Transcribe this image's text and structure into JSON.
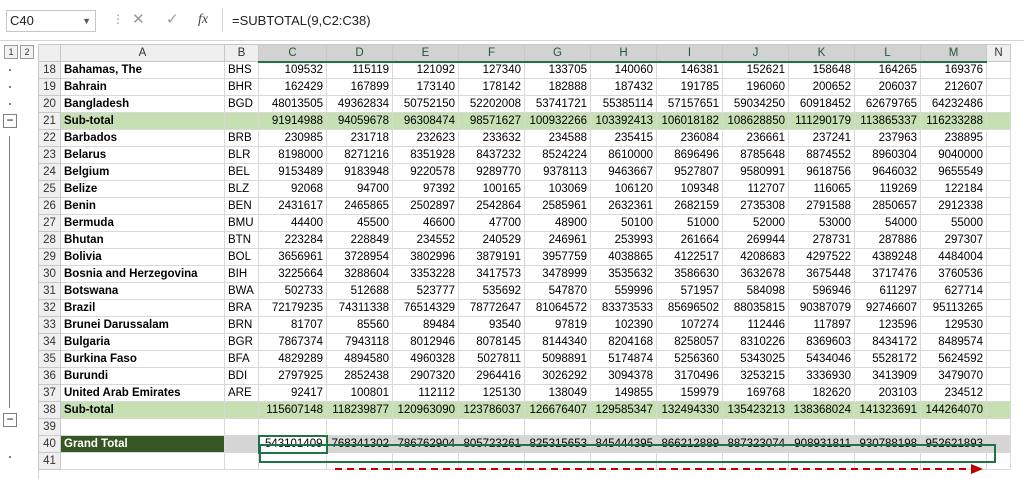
{
  "namebox": {
    "value": "C40"
  },
  "formula": {
    "fx": "fx",
    "value": "=SUBTOTAL(9,C2:C38)"
  },
  "levels": [
    "1",
    "2"
  ],
  "columns": [
    "A",
    "B",
    "C",
    "D",
    "E",
    "F",
    "G",
    "H",
    "I",
    "J",
    "K",
    "L",
    "M",
    "N"
  ],
  "rows": [
    {
      "n": "18",
      "type": "data",
      "name": "Bahamas, The",
      "code": "BHS",
      "v": [
        "109532",
        "115119",
        "121092",
        "127340",
        "133705",
        "140060",
        "146381",
        "152621",
        "158648",
        "164265",
        "169376"
      ]
    },
    {
      "n": "19",
      "type": "data",
      "name": "Bahrain",
      "code": "BHR",
      "v": [
        "162429",
        "167899",
        "173140",
        "178142",
        "182888",
        "187432",
        "191785",
        "196060",
        "200652",
        "206037",
        "212607"
      ]
    },
    {
      "n": "20",
      "type": "data",
      "name": "Bangladesh",
      "code": "BGD",
      "v": [
        "48013505",
        "49362834",
        "50752150",
        "52202008",
        "53741721",
        "55385114",
        "57157651",
        "59034250",
        "60918452",
        "62679765",
        "64232486"
      ]
    },
    {
      "n": "21",
      "type": "sub",
      "name": "Sub-total",
      "code": "",
      "v": [
        "91914988",
        "94059678",
        "96308474",
        "98571627",
        "100932266",
        "103392413",
        "106018182",
        "108628850",
        "111290179",
        "113865337",
        "116233288"
      ]
    },
    {
      "n": "22",
      "type": "data",
      "name": "Barbados",
      "code": "BRB",
      "v": [
        "230985",
        "231718",
        "232623",
        "233632",
        "234588",
        "235415",
        "236084",
        "236661",
        "237241",
        "237963",
        "238895"
      ]
    },
    {
      "n": "23",
      "type": "data",
      "name": "Belarus",
      "code": "BLR",
      "v": [
        "8198000",
        "8271216",
        "8351928",
        "8437232",
        "8524224",
        "8610000",
        "8696496",
        "8785648",
        "8874552",
        "8960304",
        "9040000"
      ]
    },
    {
      "n": "24",
      "type": "data",
      "name": "Belgium",
      "code": "BEL",
      "v": [
        "9153489",
        "9183948",
        "9220578",
        "9289770",
        "9378113",
        "9463667",
        "9527807",
        "9580991",
        "9618756",
        "9646032",
        "9655549"
      ]
    },
    {
      "n": "25",
      "type": "data",
      "name": "Belize",
      "code": "BLZ",
      "v": [
        "92068",
        "94700",
        "97392",
        "100165",
        "103069",
        "106120",
        "109348",
        "112707",
        "116065",
        "119269",
        "122184"
      ]
    },
    {
      "n": "26",
      "type": "data",
      "name": "Benin",
      "code": "BEN",
      "v": [
        "2431617",
        "2465865",
        "2502897",
        "2542864",
        "2585961",
        "2632361",
        "2682159",
        "2735308",
        "2791588",
        "2850657",
        "2912338"
      ]
    },
    {
      "n": "27",
      "type": "data",
      "name": "Bermuda",
      "code": "BMU",
      "v": [
        "44400",
        "45500",
        "46600",
        "47700",
        "48900",
        "50100",
        "51000",
        "52000",
        "53000",
        "54000",
        "55000"
      ]
    },
    {
      "n": "28",
      "type": "data",
      "name": "Bhutan",
      "code": "BTN",
      "v": [
        "223284",
        "228849",
        "234552",
        "240529",
        "246961",
        "253993",
        "261664",
        "269944",
        "278731",
        "287886",
        "297307"
      ]
    },
    {
      "n": "29",
      "type": "data",
      "name": "Bolivia",
      "code": "BOL",
      "v": [
        "3656961",
        "3728954",
        "3802996",
        "3879191",
        "3957759",
        "4038865",
        "4122517",
        "4208683",
        "4297522",
        "4389248",
        "4484004"
      ]
    },
    {
      "n": "30",
      "type": "data",
      "name": "Bosnia and Herzegovina",
      "code": "BIH",
      "v": [
        "3225664",
        "3288604",
        "3353228",
        "3417573",
        "3478999",
        "3535632",
        "3586630",
        "3632678",
        "3675448",
        "3717476",
        "3760536"
      ]
    },
    {
      "n": "31",
      "type": "data",
      "name": "Botswana",
      "code": "BWA",
      "v": [
        "502733",
        "512688",
        "523777",
        "535692",
        "547870",
        "559996",
        "571957",
        "584098",
        "596946",
        "611297",
        "627714"
      ]
    },
    {
      "n": "32",
      "type": "data",
      "name": "Brazil",
      "code": "BRA",
      "v": [
        "72179235",
        "74311338",
        "76514329",
        "78772647",
        "81064572",
        "83373533",
        "85696502",
        "88035815",
        "90387079",
        "92746607",
        "95113265"
      ]
    },
    {
      "n": "33",
      "type": "data",
      "name": "Brunei Darussalam",
      "code": "BRN",
      "v": [
        "81707",
        "85560",
        "89484",
        "93540",
        "97819",
        "102390",
        "107274",
        "112446",
        "117897",
        "123596",
        "129530"
      ]
    },
    {
      "n": "34",
      "type": "data",
      "name": "Bulgaria",
      "code": "BGR",
      "v": [
        "7867374",
        "7943118",
        "8012946",
        "8078145",
        "8144340",
        "8204168",
        "8258057",
        "8310226",
        "8369603",
        "8434172",
        "8489574"
      ]
    },
    {
      "n": "35",
      "type": "data",
      "name": "Burkina Faso",
      "code": "BFA",
      "v": [
        "4829289",
        "4894580",
        "4960328",
        "5027811",
        "5098891",
        "5174874",
        "5256360",
        "5343025",
        "5434046",
        "5528172",
        "5624592"
      ]
    },
    {
      "n": "36",
      "type": "data",
      "name": "Burundi",
      "code": "BDI",
      "v": [
        "2797925",
        "2852438",
        "2907320",
        "2964416",
        "3026292",
        "3094378",
        "3170496",
        "3253215",
        "3336930",
        "3413909",
        "3479070"
      ]
    },
    {
      "n": "37",
      "type": "data",
      "name": "United Arab Emirates",
      "code": "ARE",
      "v": [
        "92417",
        "100801",
        "112112",
        "125130",
        "138049",
        "149855",
        "159979",
        "169768",
        "182620",
        "203103",
        "234512"
      ]
    },
    {
      "n": "38",
      "type": "sub",
      "name": "Sub-total",
      "code": "",
      "v": [
        "115607148",
        "118239877",
        "120963090",
        "123786037",
        "126676407",
        "129585347",
        "132494330",
        "135423213",
        "138368024",
        "141323691",
        "144264070"
      ]
    },
    {
      "n": "39",
      "type": "blank",
      "name": "",
      "code": "",
      "v": [
        "",
        "",
        "",
        "",
        "",
        "",
        "",
        "",
        "",
        "",
        ""
      ]
    },
    {
      "n": "40",
      "type": "gt",
      "name": "Grand Total",
      "code": "",
      "v": [
        "543101409",
        "768341302",
        "786762904",
        "805723261",
        "825315653",
        "845444395",
        "866212889",
        "887323074",
        "908931811",
        "930788198",
        "952621893"
      ]
    },
    {
      "n": "41",
      "type": "blank",
      "name": "",
      "code": "",
      "v": [
        "",
        "",
        "",
        "",
        "",
        "",
        "",
        "",
        "",
        "",
        ""
      ]
    }
  ],
  "colors": {
    "subtotal": "#c6e0b4",
    "grandtotal_label": "#375623",
    "selection": "#217346",
    "arrow": "#c00000"
  }
}
